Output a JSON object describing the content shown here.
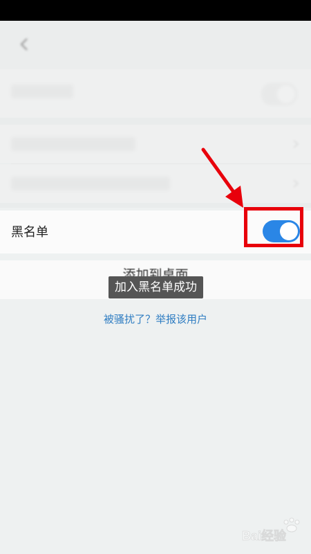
{
  "statusbar": {},
  "header": {
    "title": "",
    "back_icon": "back-arrow-icon"
  },
  "settings": {
    "row1_label": "",
    "row2_label": "",
    "row3_label": "",
    "blacklist_label": "黑名单",
    "blacklist_on": true,
    "add_to_desktop_label": "添加到桌面"
  },
  "toast": {
    "text": "加入黑名单成功"
  },
  "report": {
    "link_text": "被骚扰了？举报该用户"
  },
  "annotation": {
    "arrow_color": "#e8000b",
    "box_color": "#e8000b"
  },
  "colors": {
    "accent": "#2a86e6",
    "link": "#2f7dc2"
  },
  "watermark": {
    "icon": "baidu-paw-icon",
    "text": "Bai经验"
  }
}
